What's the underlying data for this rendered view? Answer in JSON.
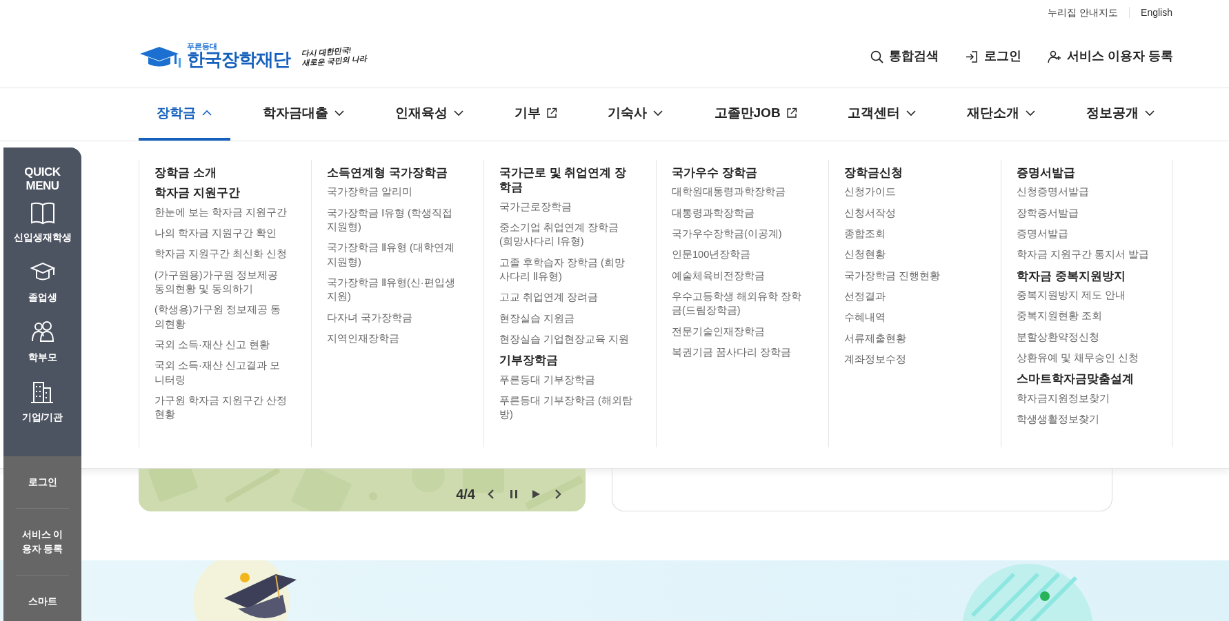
{
  "utility_links": [
    "누리집 안내지도",
    "English"
  ],
  "logo": {
    "tagline": "푸른등대",
    "name": "한국장학재단",
    "slogan": [
      "다시 대한민국!",
      "새로운 국민의 나라"
    ]
  },
  "header_actions": [
    "통합검색",
    "로그인",
    "서비스 이용자 등록"
  ],
  "nav": [
    {
      "label": "장학금",
      "kind": "dropdown",
      "selected": true,
      "expanded": true
    },
    {
      "label": "학자금대출",
      "kind": "dropdown",
      "selected": false,
      "expanded": false
    },
    {
      "label": "인재육성",
      "kind": "dropdown",
      "selected": false,
      "expanded": false
    },
    {
      "label": "기부",
      "kind": "external",
      "selected": false
    },
    {
      "label": "기숙사",
      "kind": "dropdown",
      "selected": false,
      "expanded": false
    },
    {
      "label": "고졸만JOB",
      "kind": "external",
      "selected": false
    },
    {
      "label": "고객센터",
      "kind": "dropdown",
      "selected": false,
      "expanded": false
    },
    {
      "label": "재단소개",
      "kind": "dropdown",
      "selected": false,
      "expanded": false
    },
    {
      "label": "정보공개",
      "kind": "dropdown",
      "selected": false,
      "expanded": false
    }
  ],
  "mega_menu": [
    {
      "groups": [
        {
          "heading": "장학금 소개"
        },
        {
          "heading": "학자금 지원구간",
          "items": [
            "한눈에 보는 학자금 지원구간",
            "나의 학자금 지원구간 확인",
            "학자금 지원구간 최신화 신청",
            "(가구원용)가구원 정보제공 동의현황 및 동의하기",
            "(학생용)가구원 정보제공 동의현황",
            "국외 소득·재산 신고 현황",
            "국외 소득·재산 신고결과 모니터링",
            "가구원 학자금 지원구간 산정 현황"
          ]
        }
      ]
    },
    {
      "groups": [
        {
          "heading": "소득연계형 국가장학금",
          "items": [
            "국가장학금 알리미",
            "국가장학금 Ⅰ유형 (학생직접지원형)",
            "국가장학금 Ⅱ유형 (대학연계지원형)",
            "국가장학금 Ⅱ유형(신·편입생지원)",
            "다자녀 국가장학금",
            "지역인재장학금"
          ]
        }
      ]
    },
    {
      "groups": [
        {
          "heading": "국가근로 및 취업연계 장학금",
          "items": [
            "국가근로장학금",
            "중소기업 취업연계 장학금 (희망사다리 Ⅰ유형)",
            "고졸 후학습자 장학금 (희망사다리 Ⅱ유형)",
            "고교 취업연계 장려금",
            "현장실습 지원금",
            "현장실습 기업현장교육 지원"
          ]
        },
        {
          "heading": "기부장학금",
          "items": [
            "푸른등대 기부장학금",
            "푸른등대 기부장학금 (해외탐방)"
          ]
        }
      ]
    },
    {
      "groups": [
        {
          "heading": "국가우수 장학금",
          "items": [
            "대학원대통령과학장학금",
            "대통령과학장학금",
            "국가우수장학금(이공계)",
            "인문100년장학금",
            "예술체육비전장학금",
            "우수고등학생 해외유학 장학금(드림장학금)",
            "전문기술인재장학금",
            "복권기금 꿈사다리 장학금"
          ]
        }
      ]
    },
    {
      "groups": [
        {
          "heading": "장학금신청",
          "items": [
            "신청가이드",
            "신청서작성",
            "종합조회",
            "신청현황",
            "국가장학금 진행현황",
            "선정결과",
            "수혜내역",
            "서류제출현황",
            "계좌정보수정"
          ]
        }
      ]
    },
    {
      "groups": [
        {
          "heading": "증명서발급",
          "items": [
            "신청증명서발급",
            "장학증서발급",
            "증명서발급",
            "학자금 지원구간 통지서 발급"
          ]
        },
        {
          "heading": "학자금 중복지원방지",
          "items": [
            "중복지원방지 제도 안내",
            "중복지원현황 조회",
            "분할상환약정신청",
            "상환유예 및 채무승인 신청"
          ]
        },
        {
          "heading": "스마트학자금맞춤설계",
          "items": [
            "학자금지원정보찾기",
            "학생생활정보찾기"
          ]
        }
      ]
    }
  ],
  "carousel": {
    "counter": "4/4"
  },
  "quick_menu": {
    "title": "QUICK MENU",
    "items": [
      "신입생재학생",
      "졸업생",
      "학부모",
      "기업/기관"
    ],
    "links": [
      "로그인",
      "서비스 이용자 등록",
      "스마트"
    ]
  }
}
